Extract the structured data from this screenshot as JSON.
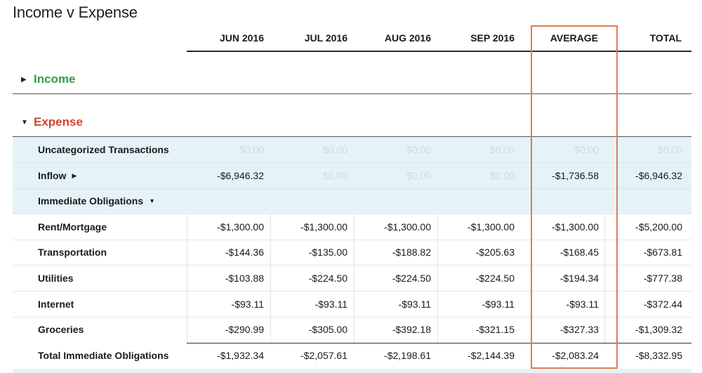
{
  "title": "Income v Expense",
  "columns": [
    "JUN 2016",
    "JUL 2016",
    "AUG 2016",
    "SEP 2016",
    "AVERAGE",
    "TOTAL"
  ],
  "groups": {
    "income": {
      "label": "Income",
      "caret": "▶"
    },
    "expense": {
      "label": "Expense",
      "caret": "▼"
    }
  },
  "rows": [
    {
      "label": "Uncategorized Transactions",
      "caret": "",
      "values": [
        "$0.00",
        "$0.00",
        "$0.00",
        "$0.00",
        "$0.00",
        "$0.00"
      ],
      "zero": [
        true,
        true,
        true,
        true,
        true,
        true
      ]
    },
    {
      "label": "Inflow",
      "caret": "▶",
      "values": [
        "-$6,946.32",
        "$0.00",
        "$0.00",
        "$0.00",
        "-$1,736.58",
        "-$6,946.32"
      ],
      "zero": [
        false,
        true,
        true,
        true,
        false,
        false
      ]
    },
    {
      "label": "Immediate Obligations",
      "caret": "▼",
      "values": [
        "",
        "",
        "",
        "",
        "",
        ""
      ],
      "zero": [
        false,
        false,
        false,
        false,
        false,
        false
      ]
    },
    {
      "label": "Rent/Mortgage",
      "caret": "",
      "values": [
        "-$1,300.00",
        "-$1,300.00",
        "-$1,300.00",
        "-$1,300.00",
        "-$1,300.00",
        "-$5,200.00"
      ],
      "zero": [
        false,
        false,
        false,
        false,
        false,
        false
      ]
    },
    {
      "label": "Transportation",
      "caret": "",
      "values": [
        "-$144.36",
        "-$135.00",
        "-$188.82",
        "-$205.63",
        "-$168.45",
        "-$673.81"
      ],
      "zero": [
        false,
        false,
        false,
        false,
        false,
        false
      ]
    },
    {
      "label": "Utilities",
      "caret": "",
      "values": [
        "-$103.88",
        "-$224.50",
        "-$224.50",
        "-$224.50",
        "-$194.34",
        "-$777.38"
      ],
      "zero": [
        false,
        false,
        false,
        false,
        false,
        false
      ]
    },
    {
      "label": "Internet",
      "caret": "",
      "values": [
        "-$93.11",
        "-$93.11",
        "-$93.11",
        "-$93.11",
        "-$93.11",
        "-$372.44"
      ],
      "zero": [
        false,
        false,
        false,
        false,
        false,
        false
      ]
    },
    {
      "label": "Groceries",
      "caret": "",
      "values": [
        "-$290.99",
        "-$305.00",
        "-$392.18",
        "-$321.15",
        "-$327.33",
        "-$1,309.32"
      ],
      "zero": [
        false,
        false,
        false,
        false,
        false,
        false
      ]
    },
    {
      "label": "Total Immediate Obligations",
      "caret": "",
      "values": [
        "-$1,932.34",
        "-$2,057.61",
        "-$2,198.61",
        "-$2,144.39",
        "-$2,083.24",
        "-$8,332.95"
      ],
      "zero": [
        false,
        false,
        false,
        false,
        false,
        false
      ]
    }
  ],
  "colors": {
    "income": "#2e9e4a",
    "expense": "#d5432b",
    "highlight": "#e07b52",
    "row_bg": "#e5f3f8"
  }
}
